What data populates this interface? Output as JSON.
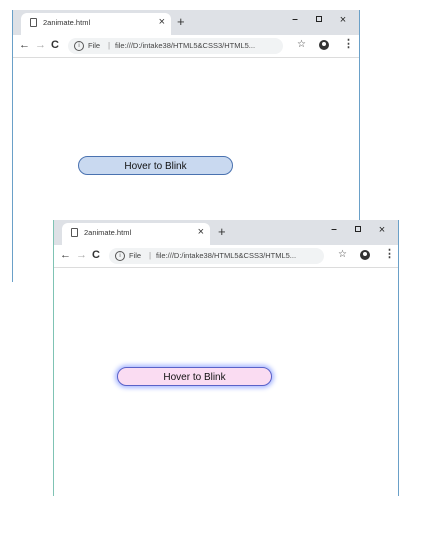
{
  "windows": [
    {
      "tab": {
        "title": "2animate.html",
        "close_glyph": "×",
        "new_tab_glyph": "+"
      },
      "window_controls": {
        "minimize": "–",
        "close": "×"
      },
      "toolbar": {
        "back_glyph": "←",
        "forward_glyph": "→",
        "reload_glyph": "C",
        "info_glyph": "i",
        "scheme_label": "File",
        "url": "file:///D:/intake38/HTML5&CSS3/HTML5...",
        "bookmark_glyph": "☆",
        "menu_glyph": "⋮"
      },
      "page": {
        "button_label": "Hover to Blink",
        "button_state": "normal"
      }
    },
    {
      "tab": {
        "title": "2animate.html",
        "close_glyph": "×",
        "new_tab_glyph": "+"
      },
      "window_controls": {
        "minimize": "–",
        "close": "×"
      },
      "toolbar": {
        "back_glyph": "←",
        "forward_glyph": "→",
        "reload_glyph": "C",
        "info_glyph": "i",
        "scheme_label": "File",
        "url": "file:///D:/intake38/HTML5&CSS3/HTML5...",
        "bookmark_glyph": "☆",
        "menu_glyph": "⋮"
      },
      "page": {
        "button_label": "Hover to Blink",
        "button_state": "hovered"
      }
    }
  ],
  "colors": {
    "button_normal_bg": "#c9d9f0",
    "button_hover_bg": "#fadcf2",
    "button_hover_glow": "#a9b8ff",
    "titlebar_bg": "#dee1e6"
  },
  "icons": [
    "file-icon",
    "info-icon",
    "star-icon",
    "account-icon",
    "menu-icon"
  ]
}
